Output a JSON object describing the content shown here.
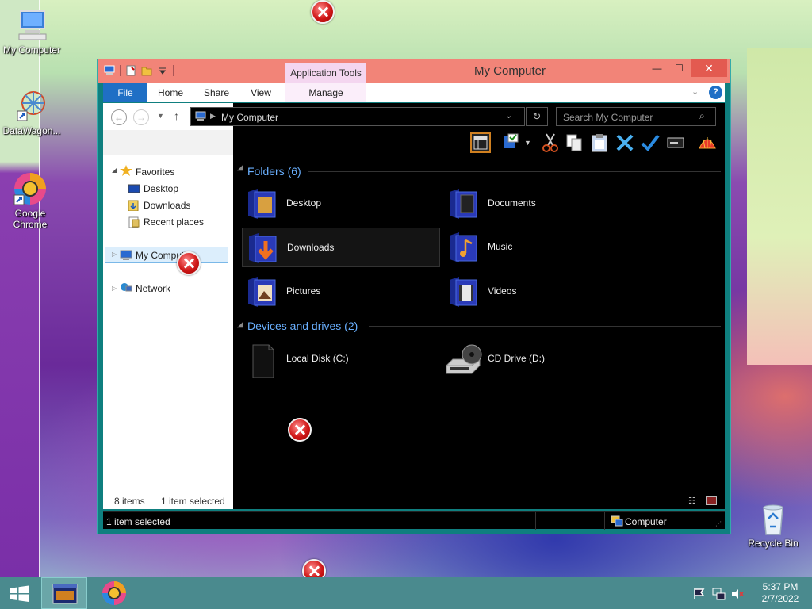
{
  "desktop": {
    "icons": [
      {
        "label": "My Computer"
      },
      {
        "label": "DataWagon..."
      },
      {
        "label": "Google Chrome"
      },
      {
        "label": "Recycle Bin"
      }
    ]
  },
  "window": {
    "title": "My Computer",
    "context_tab_group": "Application Tools",
    "controls": {
      "minimize": "—",
      "maximize": "☐",
      "close": "✕"
    },
    "ribbon_tabs": [
      "File",
      "Home",
      "Share",
      "View",
      "Manage"
    ],
    "address": {
      "path": "My Computer"
    },
    "search": {
      "placeholder": "Search My Computer"
    },
    "nav_tree": {
      "favorites": "Favorites",
      "favorites_items": [
        "Desktop",
        "Downloads",
        "Recent places"
      ],
      "computer": "My Computer",
      "network": "Network"
    },
    "groups": [
      {
        "title": "Folders (6)",
        "items": [
          "Desktop",
          "Documents",
          "Downloads",
          "Music",
          "Pictures",
          "Videos"
        ]
      },
      {
        "title": "Devices and drives (2)",
        "items": [
          "Local Disk (C:)",
          "CD Drive (D:)"
        ]
      }
    ],
    "selected_item": "Downloads",
    "nav_status": {
      "items": "8 items",
      "selected": "1 item selected"
    },
    "status_bar": {
      "left": "1 item selected",
      "right": "Computer"
    }
  },
  "taskbar": {
    "clock_time": "5:37 PM",
    "clock_date": "2/7/2022"
  },
  "colors": {
    "titlebar": "#f28478",
    "file_tab": "#1f6fc5",
    "content_bg": "#000000",
    "group_header": "#6ab0ff",
    "taskbar": "#4a8a8e"
  }
}
